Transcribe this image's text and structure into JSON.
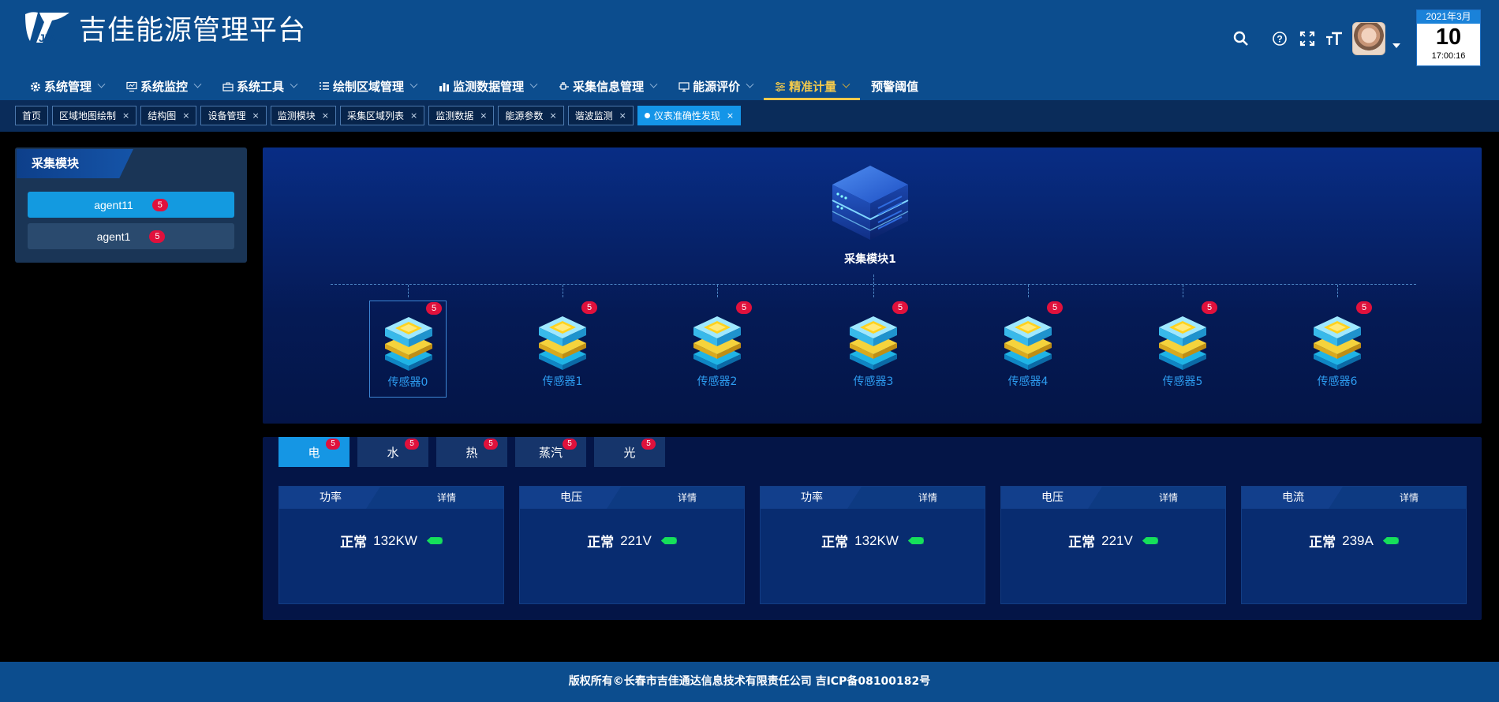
{
  "app": {
    "title": "吉佳能源管理平台",
    "logo_text": "JIA"
  },
  "calendar": {
    "month": "2021年3月",
    "day": "10",
    "time": "17:00:16"
  },
  "nav": [
    {
      "label": "系统管理",
      "icon": "gear-icon"
    },
    {
      "label": "系统监控",
      "icon": "monitor-icon"
    },
    {
      "label": "系统工具",
      "icon": "toolbox-icon"
    },
    {
      "label": "绘制区域管理",
      "icon": "list-icon"
    },
    {
      "label": "监测数据管理",
      "icon": "bar-chart-icon"
    },
    {
      "label": "采集信息管理",
      "icon": "plug-icon"
    },
    {
      "label": "能源评价",
      "icon": "screen-icon"
    },
    {
      "label": "精准计量",
      "icon": "sliders-icon",
      "active": true
    },
    {
      "label": "预警阈值",
      "icon": ""
    }
  ],
  "tabs": [
    {
      "label": "首页"
    },
    {
      "label": "区域地图绘制",
      "close": "×"
    },
    {
      "label": "结构图",
      "close": "×"
    },
    {
      "label": "设备管理",
      "close": "×"
    },
    {
      "label": "监测模块",
      "close": "×"
    },
    {
      "label": "采集区域列表",
      "close": "×"
    },
    {
      "label": "监测数据",
      "close": "×"
    },
    {
      "label": "能源参数",
      "close": "×"
    },
    {
      "label": "谐波监测",
      "close": "×"
    },
    {
      "label": "仪表准确性发现",
      "close": "×",
      "active": true
    }
  ],
  "left_panel": {
    "title": "采集模块",
    "agents": [
      {
        "label": "agent11",
        "count": "5",
        "active": true
      },
      {
        "label": "agent1",
        "count": "5"
      }
    ]
  },
  "topology": {
    "module_label": "采集模块1",
    "sensors": [
      {
        "label": "传感器0",
        "count": "5",
        "selected": true
      },
      {
        "label": "传感器1",
        "count": "5"
      },
      {
        "label": "传感器2",
        "count": "5"
      },
      {
        "label": "传感器3",
        "count": "5"
      },
      {
        "label": "传感器4",
        "count": "5"
      },
      {
        "label": "传感器5",
        "count": "5"
      },
      {
        "label": "传感器6",
        "count": "5"
      }
    ]
  },
  "energy_tabs": [
    {
      "label": "电",
      "count": "5",
      "active": true
    },
    {
      "label": "水",
      "count": "5"
    },
    {
      "label": "热",
      "count": "5"
    },
    {
      "label": "蒸汽",
      "count": "5"
    },
    {
      "label": "光",
      "count": "5"
    }
  ],
  "cards": [
    {
      "title": "功率",
      "detail": "详情",
      "status": "正常",
      "value": "132KW"
    },
    {
      "title": "电压",
      "detail": "详情",
      "status": "正常",
      "value": "221V"
    },
    {
      "title": "功率",
      "detail": "详情",
      "status": "正常",
      "value": "132KW"
    },
    {
      "title": "电压",
      "detail": "详情",
      "status": "正常",
      "value": "221V"
    },
    {
      "title": "电流",
      "detail": "详情",
      "status": "正常",
      "value": "239A"
    }
  ],
  "footer": {
    "text": "版权所有©长春市吉佳通达信息技术有限责任公司 吉ICP备08100182号"
  },
  "colors": {
    "header": "#0c4d8e",
    "accent": "#1495e8",
    "active_nav": "#f2c94c",
    "badge": "#e0113c",
    "status_led": "#16e05a"
  }
}
